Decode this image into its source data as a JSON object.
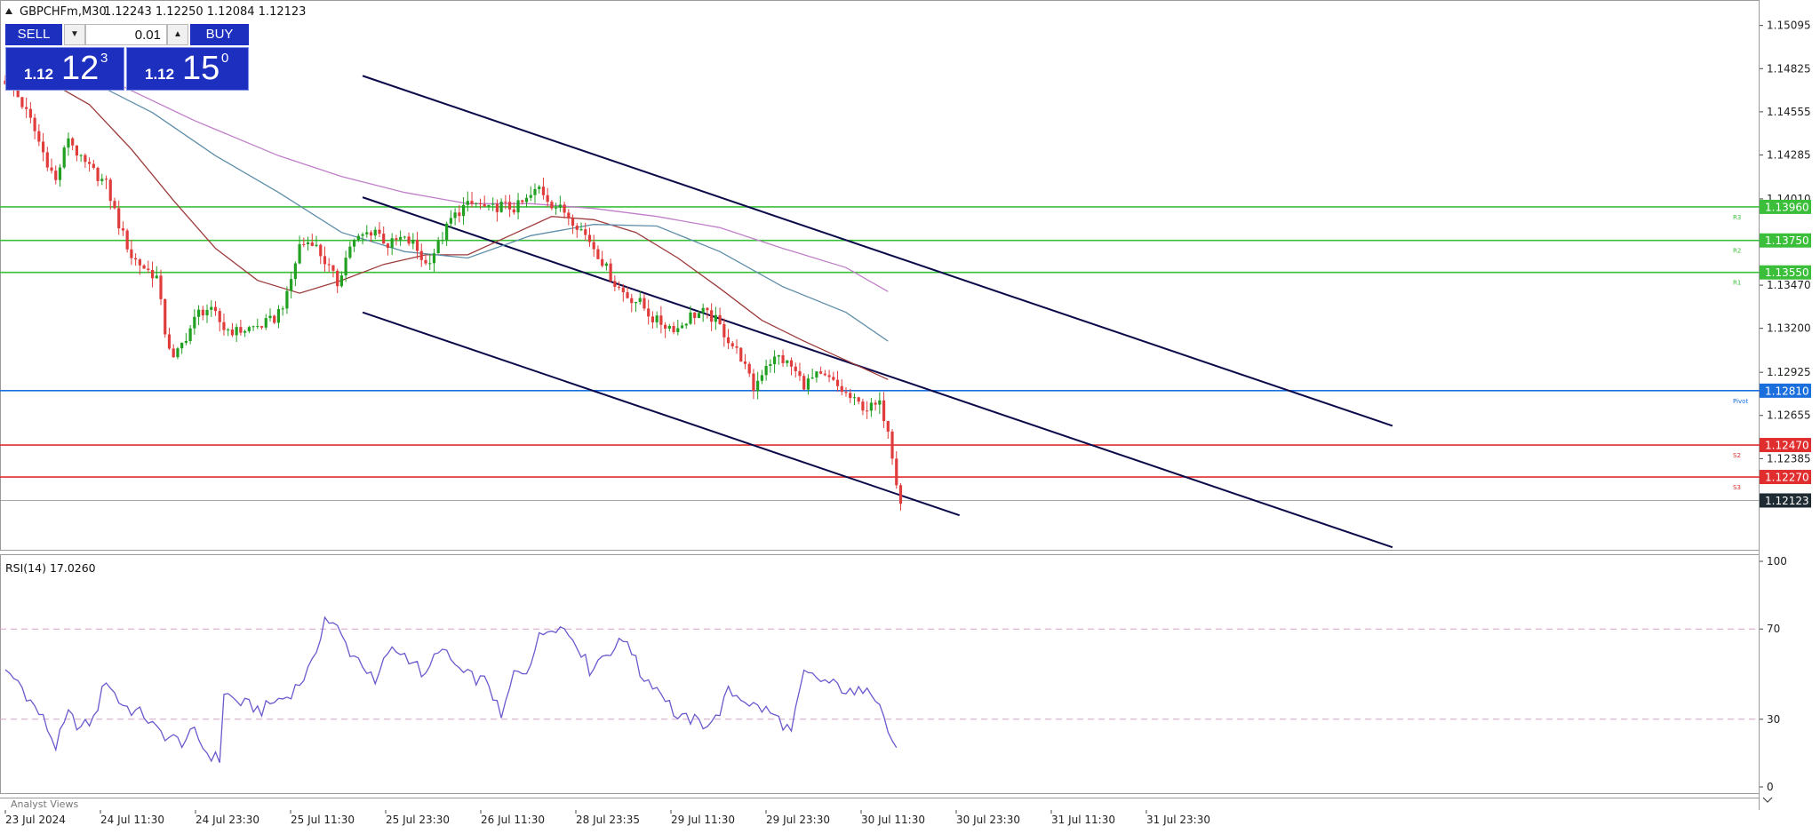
{
  "header": {
    "symbol_text": "GBPCHFm,M30",
    "ohlc_text": "1.12243 1.12250 1.12084 1.12123"
  },
  "trade_panel": {
    "sell_label": "SELL",
    "buy_label": "BUY",
    "lot_value": "0.01",
    "sell_prefix": "1.12",
    "sell_big": "12",
    "sell_sup": "3",
    "buy_prefix": "1.12",
    "buy_big": "15",
    "buy_sup": "0"
  },
  "indicator": {
    "label": "RSI(14) 17.0260"
  },
  "footer": {
    "label": "Analyst Views"
  },
  "colors": {
    "bull_candle": "#22a022",
    "bear_candle": "#e03c3c",
    "pivot": "#1b6fdc",
    "resistance": "#3bbf3b",
    "support": "#e02e2e",
    "channel": "#0a0a4a",
    "ma_fast": "#9c3b3b",
    "ma_mid": "#5f8ea8",
    "ma_slow": "#c07fc9",
    "rsi": "#6a5acd"
  },
  "chart_data": [
    {
      "type": "line",
      "subtype": "candlestick",
      "y_ticks": [
        "1.15095",
        "1.14825",
        "1.14555",
        "1.14285",
        "1.14010",
        "1.13470",
        "1.13200",
        "1.12925",
        "1.12655",
        "1.12385"
      ],
      "ylim": [
        1.1182,
        1.1521
      ],
      "x_tick_labels": [
        "23 Jul 2024",
        "24 Jul 11:30",
        "24 Jul 23:30",
        "25 Jul 11:30",
        "25 Jul 23:30",
        "26 Jul 11:30",
        "28 Jul 23:35",
        "29 Jul 11:30",
        "29 Jul 23:30",
        "30 Jul 11:30",
        "30 Jul 23:30",
        "31 Jul 11:30",
        "31 Jul 23:30"
      ],
      "price_anchors": [
        [
          0,
          1.1475
        ],
        [
          3,
          1.1465
        ],
        [
          6,
          1.145
        ],
        [
          9,
          1.143
        ],
        [
          12,
          1.1412
        ],
        [
          15,
          1.144
        ],
        [
          18,
          1.1425
        ],
        [
          21,
          1.1418
        ],
        [
          24,
          1.141
        ],
        [
          27,
          1.1385
        ],
        [
          30,
          1.1365
        ],
        [
          33,
          1.1358
        ],
        [
          36,
          1.1352
        ],
        [
          38,
          1.1318
        ],
        [
          40,
          1.13
        ],
        [
          42,
          1.131
        ],
        [
          44,
          1.132
        ],
        [
          46,
          1.133
        ],
        [
          48,
          1.1332
        ],
        [
          50,
          1.1328
        ],
        [
          52,
          1.132
        ],
        [
          55,
          1.1318
        ],
        [
          58,
          1.132
        ],
        [
          61,
          1.1322
        ],
        [
          64,
          1.1326
        ],
        [
          67,
          1.134
        ],
        [
          70,
          1.1372
        ],
        [
          73,
          1.1375
        ],
        [
          76,
          1.1362
        ],
        [
          79,
          1.1348
        ],
        [
          82,
          1.1372
        ],
        [
          85,
          1.1378
        ],
        [
          88,
          1.1382
        ],
        [
          91,
          1.1372
        ],
        [
          94,
          1.1376
        ],
        [
          97,
          1.1373
        ],
        [
          100,
          1.136
        ],
        [
          103,
          1.1372
        ],
        [
          106,
          1.1388
        ],
        [
          109,
          1.1396
        ],
        [
          112,
          1.1398
        ],
        [
          115,
          1.1394
        ],
        [
          118,
          1.1397
        ],
        [
          121,
          1.1395
        ],
        [
          124,
          1.14
        ],
        [
          127,
          1.1408
        ],
        [
          130,
          1.1398
        ],
        [
          133,
          1.1393
        ],
        [
          136,
          1.1385
        ],
        [
          139,
          1.1375
        ],
        [
          142,
          1.1362
        ],
        [
          145,
          1.1348
        ],
        [
          148,
          1.134
        ],
        [
          151,
          1.1336
        ],
        [
          154,
          1.1326
        ],
        [
          157,
          1.1322
        ],
        [
          160,
          1.132
        ],
        [
          163,
          1.1328
        ],
        [
          166,
          1.133
        ],
        [
          169,
          1.1325
        ],
        [
          172,
          1.1313
        ],
        [
          175,
          1.1302
        ],
        [
          178,
          1.1282
        ],
        [
          181,
          1.1298
        ],
        [
          184,
          1.1302
        ],
        [
          187,
          1.1296
        ],
        [
          190,
          1.1285
        ],
        [
          193,
          1.129
        ],
        [
          196,
          1.1288
        ],
        [
          199,
          1.1281
        ],
        [
          202,
          1.1274
        ],
        [
          205,
          1.127
        ],
        [
          208,
          1.1272
        ],
        [
          210,
          1.1258
        ],
        [
          212,
          1.1225
        ],
        [
          213,
          1.1212
        ]
      ],
      "horizontal_levels": [
        {
          "label": "1.13960",
          "price": 1.1396,
          "kind": "resistance",
          "tag": "R3"
        },
        {
          "label": "1.13750",
          "price": 1.1375,
          "kind": "resistance",
          "tag": "R2"
        },
        {
          "label": "1.13550",
          "price": 1.1355,
          "kind": "resistance",
          "tag": "R1"
        },
        {
          "label": "1.12810",
          "price": 1.1281,
          "kind": "pivot",
          "tag": "Pivot"
        },
        {
          "label": "1.12470",
          "price": 1.1247,
          "kind": "support",
          "tag": "S2"
        },
        {
          "label": "1.12270",
          "price": 1.1227,
          "kind": "support",
          "tag": "S3"
        },
        {
          "label": "1.12123",
          "price": 1.12123,
          "kind": "current",
          "tag": ""
        }
      ],
      "channel_lines": [
        {
          "from": [
            85,
            1.1478
          ],
          "to": [
            330,
            1.1259
          ]
        },
        {
          "from": [
            85,
            1.1402
          ],
          "to": [
            330,
            1.1183
          ]
        },
        {
          "from": [
            85,
            1.133
          ],
          "to": [
            227,
            1.1203
          ]
        }
      ],
      "moving_averages": [
        {
          "role": "fast",
          "points": [
            [
              10,
              1.1475
            ],
            [
              20,
              1.146
            ],
            [
              30,
              1.1432
            ],
            [
              40,
              1.14
            ],
            [
              50,
              1.137
            ],
            [
              60,
              1.135
            ],
            [
              70,
              1.1342
            ],
            [
              80,
              1.135
            ],
            [
              90,
              1.136
            ],
            [
              100,
              1.1366
            ],
            [
              110,
              1.1366
            ],
            [
              120,
              1.1378
            ],
            [
              130,
              1.139
            ],
            [
              140,
              1.1388
            ],
            [
              150,
              1.138
            ],
            [
              160,
              1.1364
            ],
            [
              170,
              1.1345
            ],
            [
              180,
              1.1325
            ],
            [
              190,
              1.1312
            ],
            [
              200,
              1.13
            ],
            [
              210,
              1.1288
            ]
          ]
        },
        {
          "role": "mid",
          "points": [
            [
              20,
              1.1475
            ],
            [
              35,
              1.1455
            ],
            [
              50,
              1.1428
            ],
            [
              65,
              1.1405
            ],
            [
              80,
              1.138
            ],
            [
              95,
              1.1368
            ],
            [
              110,
              1.1364
            ],
            [
              125,
              1.1378
            ],
            [
              140,
              1.1385
            ],
            [
              155,
              1.1384
            ],
            [
              170,
              1.1368
            ],
            [
              185,
              1.1346
            ],
            [
              200,
              1.133
            ],
            [
              210,
              1.1312
            ]
          ]
        },
        {
          "role": "slow",
          "points": [
            [
              25,
              1.1475
            ],
            [
              45,
              1.145
            ],
            [
              65,
              1.1428
            ],
            [
              80,
              1.1415
            ],
            [
              95,
              1.1405
            ],
            [
              110,
              1.1398
            ],
            [
              125,
              1.1398
            ],
            [
              140,
              1.1395
            ],
            [
              155,
              1.139
            ],
            [
              170,
              1.1383
            ],
            [
              185,
              1.137
            ],
            [
              200,
              1.1358
            ],
            [
              210,
              1.1343
            ]
          ]
        }
      ]
    },
    {
      "type": "line",
      "title": "RSI(14) 17.0260",
      "ylim": [
        0,
        100
      ],
      "y_ticks": [
        "100",
        "70",
        "30",
        "0"
      ],
      "levels": [
        70,
        30
      ],
      "series": [
        {
          "values_anchors": [
            [
              0,
              50
            ],
            [
              3,
              47
            ],
            [
              6,
              38
            ],
            [
              9,
              30
            ],
            [
              12,
              18
            ],
            [
              15,
              32
            ],
            [
              18,
              26
            ],
            [
              21,
              30
            ],
            [
              24,
              48
            ],
            [
              27,
              38
            ],
            [
              30,
              34
            ],
            [
              33,
              32
            ],
            [
              36,
              25
            ],
            [
              39,
              22
            ],
            [
              42,
              20
            ],
            [
              45,
              24
            ],
            [
              48,
              15
            ],
            [
              51,
              12
            ],
            [
              52,
              42
            ],
            [
              55,
              38
            ],
            [
              58,
              36
            ],
            [
              61,
              34
            ],
            [
              64,
              38
            ],
            [
              67,
              40
            ],
            [
              70,
              46
            ],
            [
              73,
              54
            ],
            [
              76,
              75
            ],
            [
              79,
              70
            ],
            [
              82,
              60
            ],
            [
              85,
              55
            ],
            [
              88,
              45
            ],
            [
              91,
              60
            ],
            [
              94,
              60
            ],
            [
              97,
              56
            ],
            [
              100,
              48
            ],
            [
              103,
              62
            ],
            [
              106,
              56
            ],
            [
              109,
              50
            ],
            [
              112,
              48
            ],
            [
              115,
              46
            ],
            [
              118,
              30
            ],
            [
              121,
              50
            ],
            [
              124,
              52
            ],
            [
              127,
              66
            ],
            [
              130,
              72
            ],
            [
              133,
              70
            ],
            [
              136,
              64
            ],
            [
              139,
              52
            ],
            [
              142,
              58
            ],
            [
              145,
              62
            ],
            [
              148,
              66
            ],
            [
              151,
              50
            ],
            [
              154,
              46
            ],
            [
              157,
              40
            ],
            [
              160,
              30
            ],
            [
              163,
              30
            ],
            [
              166,
              28
            ],
            [
              169,
              30
            ],
            [
              172,
              42
            ],
            [
              175,
              40
            ],
            [
              178,
              36
            ],
            [
              181,
              34
            ],
            [
              184,
              30
            ],
            [
              187,
              24
            ],
            [
              190,
              50
            ],
            [
              193,
              48
            ],
            [
              196,
              46
            ],
            [
              199,
              44
            ],
            [
              202,
              40
            ],
            [
              205,
              46
            ],
            [
              208,
              38
            ],
            [
              210,
              24
            ],
            [
              212,
              18
            ]
          ]
        }
      ]
    }
  ]
}
